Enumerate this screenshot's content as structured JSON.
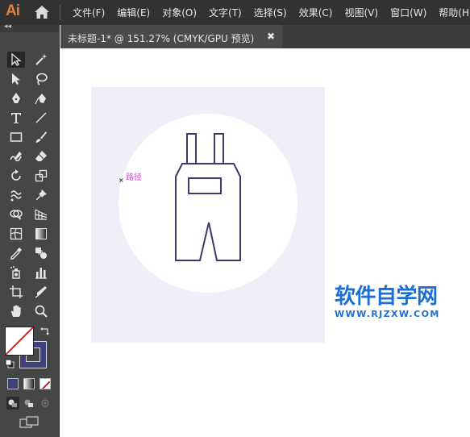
{
  "app": {
    "logo": "Ai"
  },
  "menu": {
    "items": [
      {
        "label": "文件(F)"
      },
      {
        "label": "编辑(E)"
      },
      {
        "label": "对象(O)"
      },
      {
        "label": "文字(T)"
      },
      {
        "label": "选择(S)"
      },
      {
        "label": "效果(C)"
      },
      {
        "label": "视图(V)"
      },
      {
        "label": "窗口(W)"
      },
      {
        "label": "帮助(H)"
      }
    ]
  },
  "document_tab": {
    "label": "未标题-1* @ 151.27% (CMYK/GPU 预览)",
    "close": "✖"
  },
  "toolbar": {
    "collapse": "◂◂"
  },
  "canvas": {
    "path_label": "路径",
    "anchor": "×",
    "artboard_color": "#efeff8",
    "stroke_color": "#3d3a6b"
  },
  "watermark": {
    "title": "软件自学网",
    "url": "WWW.RJZXW.COM",
    "color": "#1a6fd6"
  },
  "colors": {
    "fill": "#ffffff",
    "stroke": "#40407a",
    "menubar": "#323232",
    "toolbar": "#464646"
  }
}
